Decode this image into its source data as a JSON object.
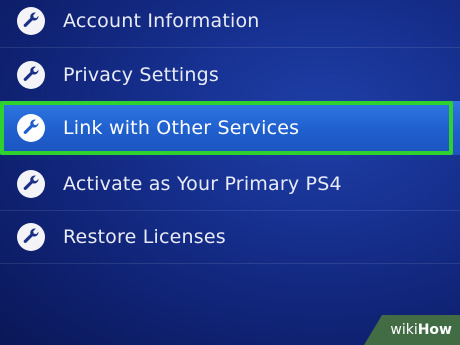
{
  "menu": {
    "items": [
      {
        "label": "Account Information",
        "icon": "wrench-icon",
        "selected": false
      },
      {
        "label": "Privacy Settings",
        "icon": "wrench-icon",
        "selected": false
      },
      {
        "label": "Link with Other Services",
        "icon": "wrench-icon",
        "selected": true
      },
      {
        "label": "Activate as Your Primary PS4",
        "icon": "wrench-icon",
        "selected": false
      },
      {
        "label": "Restore Licenses",
        "icon": "wrench-icon",
        "selected": false
      }
    ]
  },
  "colors": {
    "background": "#16308f",
    "selected": "#2a6fdc",
    "highlight_outline": "#2ed12e"
  },
  "watermark": {
    "part1": "wiki",
    "part2": "How"
  }
}
